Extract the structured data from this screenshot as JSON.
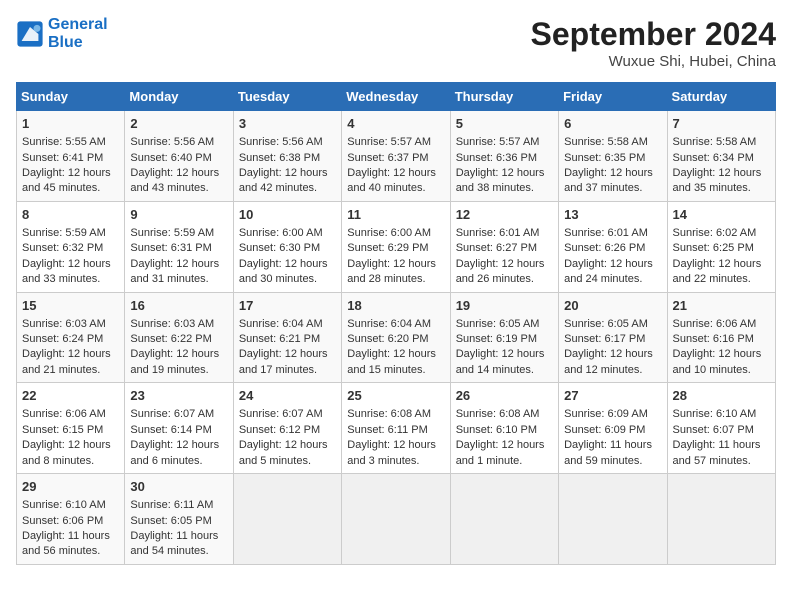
{
  "logo": {
    "line1": "General",
    "line2": "Blue"
  },
  "title": "September 2024",
  "location": "Wuxue Shi, Hubei, China",
  "days_of_week": [
    "Sunday",
    "Monday",
    "Tuesday",
    "Wednesday",
    "Thursday",
    "Friday",
    "Saturday"
  ],
  "weeks": [
    [
      {
        "day": "1",
        "lines": [
          "Sunrise: 5:55 AM",
          "Sunset: 6:41 PM",
          "Daylight: 12 hours",
          "and 45 minutes."
        ]
      },
      {
        "day": "2",
        "lines": [
          "Sunrise: 5:56 AM",
          "Sunset: 6:40 PM",
          "Daylight: 12 hours",
          "and 43 minutes."
        ]
      },
      {
        "day": "3",
        "lines": [
          "Sunrise: 5:56 AM",
          "Sunset: 6:38 PM",
          "Daylight: 12 hours",
          "and 42 minutes."
        ]
      },
      {
        "day": "4",
        "lines": [
          "Sunrise: 5:57 AM",
          "Sunset: 6:37 PM",
          "Daylight: 12 hours",
          "and 40 minutes."
        ]
      },
      {
        "day": "5",
        "lines": [
          "Sunrise: 5:57 AM",
          "Sunset: 6:36 PM",
          "Daylight: 12 hours",
          "and 38 minutes."
        ]
      },
      {
        "day": "6",
        "lines": [
          "Sunrise: 5:58 AM",
          "Sunset: 6:35 PM",
          "Daylight: 12 hours",
          "and 37 minutes."
        ]
      },
      {
        "day": "7",
        "lines": [
          "Sunrise: 5:58 AM",
          "Sunset: 6:34 PM",
          "Daylight: 12 hours",
          "and 35 minutes."
        ]
      }
    ],
    [
      {
        "day": "8",
        "lines": [
          "Sunrise: 5:59 AM",
          "Sunset: 6:32 PM",
          "Daylight: 12 hours",
          "and 33 minutes."
        ]
      },
      {
        "day": "9",
        "lines": [
          "Sunrise: 5:59 AM",
          "Sunset: 6:31 PM",
          "Daylight: 12 hours",
          "and 31 minutes."
        ]
      },
      {
        "day": "10",
        "lines": [
          "Sunrise: 6:00 AM",
          "Sunset: 6:30 PM",
          "Daylight: 12 hours",
          "and 30 minutes."
        ]
      },
      {
        "day": "11",
        "lines": [
          "Sunrise: 6:00 AM",
          "Sunset: 6:29 PM",
          "Daylight: 12 hours",
          "and 28 minutes."
        ]
      },
      {
        "day": "12",
        "lines": [
          "Sunrise: 6:01 AM",
          "Sunset: 6:27 PM",
          "Daylight: 12 hours",
          "and 26 minutes."
        ]
      },
      {
        "day": "13",
        "lines": [
          "Sunrise: 6:01 AM",
          "Sunset: 6:26 PM",
          "Daylight: 12 hours",
          "and 24 minutes."
        ]
      },
      {
        "day": "14",
        "lines": [
          "Sunrise: 6:02 AM",
          "Sunset: 6:25 PM",
          "Daylight: 12 hours",
          "and 22 minutes."
        ]
      }
    ],
    [
      {
        "day": "15",
        "lines": [
          "Sunrise: 6:03 AM",
          "Sunset: 6:24 PM",
          "Daylight: 12 hours",
          "and 21 minutes."
        ]
      },
      {
        "day": "16",
        "lines": [
          "Sunrise: 6:03 AM",
          "Sunset: 6:22 PM",
          "Daylight: 12 hours",
          "and 19 minutes."
        ]
      },
      {
        "day": "17",
        "lines": [
          "Sunrise: 6:04 AM",
          "Sunset: 6:21 PM",
          "Daylight: 12 hours",
          "and 17 minutes."
        ]
      },
      {
        "day": "18",
        "lines": [
          "Sunrise: 6:04 AM",
          "Sunset: 6:20 PM",
          "Daylight: 12 hours",
          "and 15 minutes."
        ]
      },
      {
        "day": "19",
        "lines": [
          "Sunrise: 6:05 AM",
          "Sunset: 6:19 PM",
          "Daylight: 12 hours",
          "and 14 minutes."
        ]
      },
      {
        "day": "20",
        "lines": [
          "Sunrise: 6:05 AM",
          "Sunset: 6:17 PM",
          "Daylight: 12 hours",
          "and 12 minutes."
        ]
      },
      {
        "day": "21",
        "lines": [
          "Sunrise: 6:06 AM",
          "Sunset: 6:16 PM",
          "Daylight: 12 hours",
          "and 10 minutes."
        ]
      }
    ],
    [
      {
        "day": "22",
        "lines": [
          "Sunrise: 6:06 AM",
          "Sunset: 6:15 PM",
          "Daylight: 12 hours",
          "and 8 minutes."
        ]
      },
      {
        "day": "23",
        "lines": [
          "Sunrise: 6:07 AM",
          "Sunset: 6:14 PM",
          "Daylight: 12 hours",
          "and 6 minutes."
        ]
      },
      {
        "day": "24",
        "lines": [
          "Sunrise: 6:07 AM",
          "Sunset: 6:12 PM",
          "Daylight: 12 hours",
          "and 5 minutes."
        ]
      },
      {
        "day": "25",
        "lines": [
          "Sunrise: 6:08 AM",
          "Sunset: 6:11 PM",
          "Daylight: 12 hours",
          "and 3 minutes."
        ]
      },
      {
        "day": "26",
        "lines": [
          "Sunrise: 6:08 AM",
          "Sunset: 6:10 PM",
          "Daylight: 12 hours",
          "and 1 minute."
        ]
      },
      {
        "day": "27",
        "lines": [
          "Sunrise: 6:09 AM",
          "Sunset: 6:09 PM",
          "Daylight: 11 hours",
          "and 59 minutes."
        ]
      },
      {
        "day": "28",
        "lines": [
          "Sunrise: 6:10 AM",
          "Sunset: 6:07 PM",
          "Daylight: 11 hours",
          "and 57 minutes."
        ]
      }
    ],
    [
      {
        "day": "29",
        "lines": [
          "Sunrise: 6:10 AM",
          "Sunset: 6:06 PM",
          "Daylight: 11 hours",
          "and 56 minutes."
        ]
      },
      {
        "day": "30",
        "lines": [
          "Sunrise: 6:11 AM",
          "Sunset: 6:05 PM",
          "Daylight: 11 hours",
          "and 54 minutes."
        ]
      },
      {
        "day": "",
        "lines": []
      },
      {
        "day": "",
        "lines": []
      },
      {
        "day": "",
        "lines": []
      },
      {
        "day": "",
        "lines": []
      },
      {
        "day": "",
        "lines": []
      }
    ]
  ]
}
